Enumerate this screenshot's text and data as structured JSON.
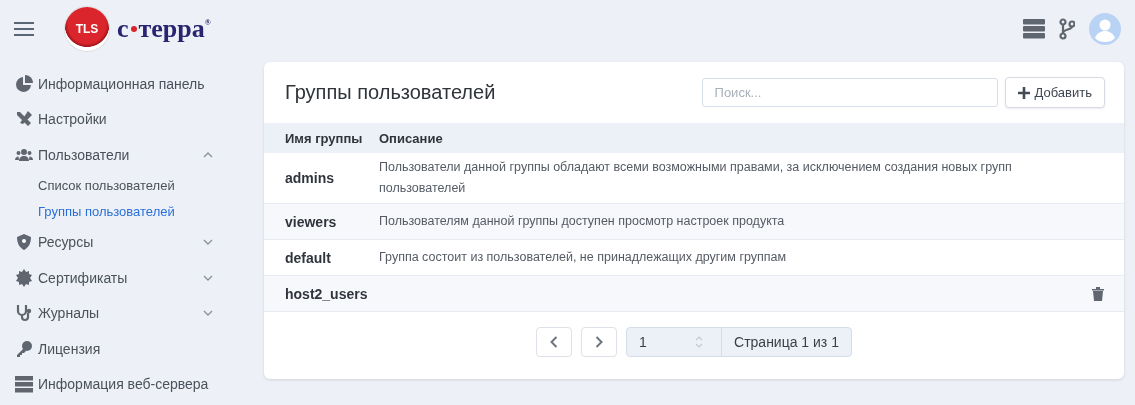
{
  "logo": {
    "badge": "TLS",
    "name_left": "с",
    "name_right": "терра",
    "mark": "®"
  },
  "sidebar": {
    "items": [
      {
        "kind": "pie",
        "label": "Информационная панель"
      },
      {
        "kind": "tools",
        "label": "Настройки"
      },
      {
        "kind": "users",
        "label": "Пользователи",
        "expanded": true,
        "children": [
          {
            "label": "Список пользователей",
            "selected": false
          },
          {
            "label": "Группы пользователей",
            "selected": true
          }
        ]
      },
      {
        "kind": "shield",
        "label": "Ресурсы",
        "expanded": false
      },
      {
        "kind": "cert",
        "label": "Сертификаты",
        "expanded": false
      },
      {
        "kind": "stetho",
        "label": "Журналы",
        "expanded": false
      },
      {
        "kind": "key",
        "label": "Лицензия"
      },
      {
        "kind": "server",
        "label": "Информация веб-сервера"
      }
    ]
  },
  "card": {
    "title": "Группы пользователей",
    "search": {
      "placeholder": "Поиск..."
    },
    "add_button": "Добавить",
    "table": {
      "columns": [
        "Имя группы",
        "Описание"
      ],
      "rows": [
        {
          "name": "admins",
          "description": "Пользователи данной группы обладают всеми возможными правами, за исключением создания новых групп пользователей",
          "hovered": false
        },
        {
          "name": "viewers",
          "description": "Пользователям данной группы доступен просмотр настроек продукта",
          "hovered": false
        },
        {
          "name": "default",
          "description": "Группа состоит из пользователей, не принадлежащих другим группам",
          "hovered": false
        },
        {
          "name": "host2_users",
          "description": "",
          "hovered": true
        }
      ]
    },
    "pagination": {
      "page": "1",
      "label": "Страница 1 из 1"
    }
  }
}
